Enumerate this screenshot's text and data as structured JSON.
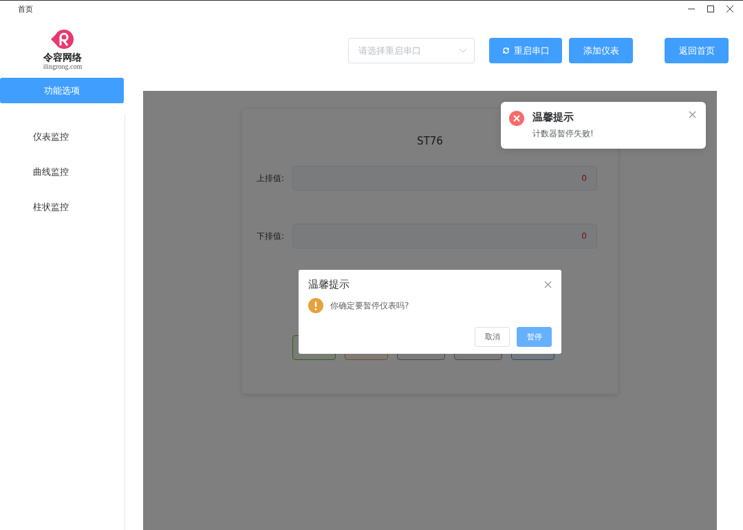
{
  "window": {
    "title": "首页"
  },
  "sidebar": {
    "logo": {
      "name": "令容网络",
      "domain": "ilingrong.com"
    },
    "items": [
      {
        "label": "功能选项",
        "selected": true
      },
      {
        "label": "仪表监控",
        "selected": false
      },
      {
        "label": "曲线监控",
        "selected": false
      },
      {
        "label": "柱状监控",
        "selected": false
      }
    ]
  },
  "toolbar": {
    "select": {
      "placeholder": "请选择重启串口"
    },
    "buttons": [
      {
        "label": "重启串口",
        "kind": "with-icon"
      },
      {
        "label": "添加仪表",
        "kind": "plain"
      }
    ],
    "home_button": "返回首页"
  },
  "card": {
    "title": "ST76",
    "fields": [
      {
        "label": "上排值:",
        "value": "0"
      },
      {
        "label": "下排值:",
        "value": "0"
      }
    ],
    "actions": [
      {
        "kind": "success"
      },
      {
        "kind": "warning"
      },
      {
        "kind": "info"
      },
      {
        "kind": "info"
      },
      {
        "kind": "primary"
      }
    ]
  },
  "notification": {
    "kind": "error",
    "title": "温馨提示",
    "message": "计数器暂停失败!"
  },
  "dialog": {
    "kind": "warning",
    "title": "温馨提示",
    "message": "你确定要暂停仪表吗?",
    "buttons": [
      {
        "label": "取消",
        "kind": "default"
      },
      {
        "label": "暂停",
        "kind": "primary"
      }
    ]
  }
}
